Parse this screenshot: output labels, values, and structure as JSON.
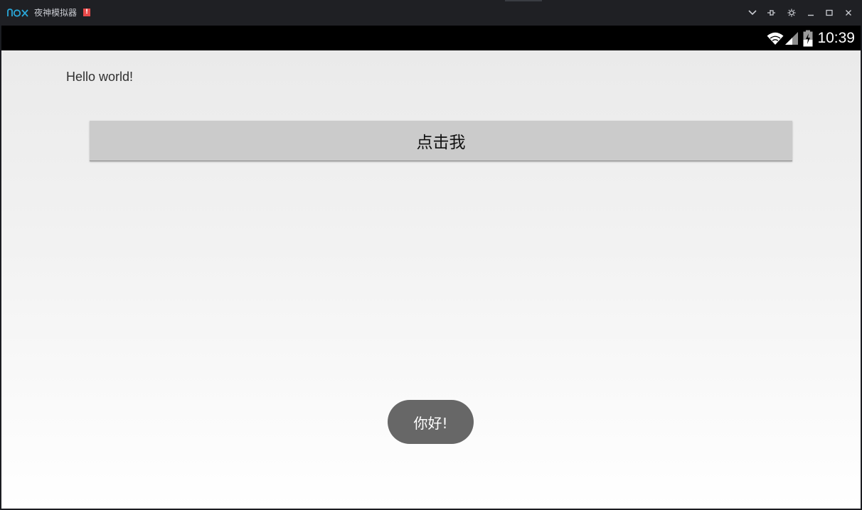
{
  "window": {
    "title": "夜神模拟器",
    "alert_badge": "!",
    "controls": [
      "chevron-down-icon",
      "pin-icon",
      "gear-icon",
      "minimize-icon",
      "maximize-icon",
      "close-icon"
    ],
    "accent_color": "#2aa7d8",
    "badge_color": "#e84a4a"
  },
  "statusbar": {
    "time": "10:39",
    "icons": [
      "wifi-icon",
      "signal-icon",
      "battery-icon"
    ]
  },
  "app": {
    "hello_text": "Hello world!",
    "button_label": "点击我",
    "toast_text": "你好!"
  }
}
